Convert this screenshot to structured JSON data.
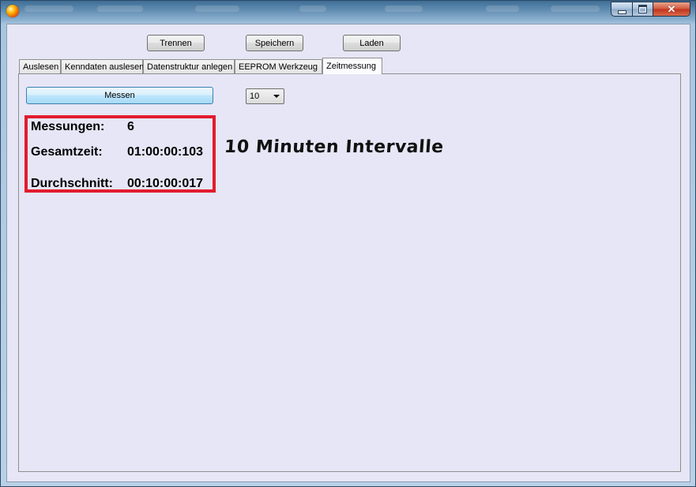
{
  "toolbar": {
    "disconnect_label": "Trennen",
    "save_label": "Speichern",
    "load_label": "Laden"
  },
  "tabs": [
    {
      "label": "Auslesen"
    },
    {
      "label": "Kenndaten auslesen"
    },
    {
      "label": "Datenstruktur anlegen"
    },
    {
      "label": "EEPROM Werkzeug"
    },
    {
      "label": "Zeitmessung",
      "active": true
    }
  ],
  "measure": {
    "button_label": "Messen",
    "interval_selected": "10"
  },
  "stats": {
    "count_label": "Messungen:",
    "count_value": "6",
    "total_label": "Gesamtzeit:",
    "total_value": "01:00:00:103",
    "average_label": "Durchschnitt:",
    "average_value": "00:10:00:017"
  },
  "annotation": {
    "text": "10 Minuten Intervalle",
    "highlight_color": "#e21b2e"
  }
}
